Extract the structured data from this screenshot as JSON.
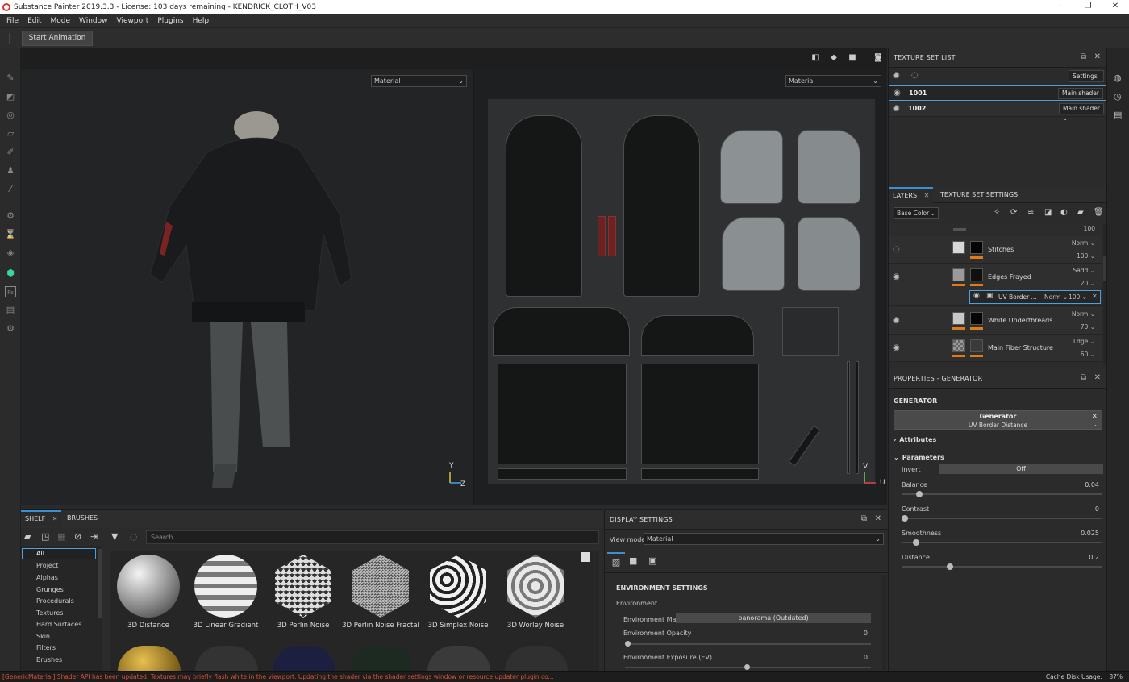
{
  "window": {
    "title": "Substance Painter 2019.3.3 - License: 103 days remaining - KENDRICK_CLOTH_V03",
    "minimize": "–",
    "maximize": "❐",
    "close": "✕"
  },
  "menu": [
    "File",
    "Edit",
    "Mode",
    "Window",
    "Viewport",
    "Plugins",
    "Help"
  ],
  "toolbar": {
    "start_animation": "Start Animation"
  },
  "viewport": {
    "left_mode": "Material",
    "right_mode": "Material",
    "axis_3d_y": "Y",
    "axis_3d_z": "Z",
    "axis_2d_v": "V",
    "axis_2d_u": "U"
  },
  "texture_set_list": {
    "title": "TEXTURE SET LIST",
    "settings": "Settings",
    "sets": [
      {
        "name": "1001",
        "shader": "Main shader"
      },
      {
        "name": "1002",
        "shader": "Main shader"
      }
    ]
  },
  "layers_panel": {
    "tab_layers": "LAYERS",
    "tab_texture_set_settings": "TEXTURE SET SETTINGS",
    "channel": "Base Color",
    "top_value": "100",
    "layers": [
      {
        "name": "Stitches",
        "blend": "Norm",
        "opacity": "100"
      },
      {
        "name": "Edges Frayed",
        "blend": "Sadd",
        "opacity": "20"
      },
      {
        "name": "White Underthreads",
        "blend": "Norm",
        "opacity": "70"
      },
      {
        "name": "Main Fiber Structure",
        "blend": "Ldge",
        "opacity": "60"
      }
    ],
    "sublayer": {
      "name": "UV Border ...",
      "blend": "Norm",
      "opacity": "100"
    }
  },
  "properties": {
    "title": "PROPERTIES - GENERATOR",
    "section": "GENERATOR",
    "generator_label": "Generator",
    "generator_name": "UV Border Distance",
    "attributes": "Attributes",
    "parameters": "Parameters",
    "invert_label": "Invert",
    "invert_value": "Off",
    "params": [
      {
        "label": "Balance",
        "value": "0.04",
        "fraction": 0.04
      },
      {
        "label": "Contrast",
        "value": "0",
        "fraction": 0.0
      },
      {
        "label": "Smoothness",
        "value": "0.025",
        "fraction": 0.025
      },
      {
        "label": "Distance",
        "value": "0.2",
        "fraction": 0.2
      }
    ]
  },
  "shelf": {
    "tab_shelf": "SHELF",
    "tab_brushes": "BRUSHES",
    "search_placeholder": "Search...",
    "categories": [
      "All",
      "Project",
      "Alphas",
      "Grunges",
      "Procedurals",
      "Textures",
      "Hard Surfaces",
      "Skin",
      "Filters",
      "Brushes"
    ],
    "items": [
      "3D Distance",
      "3D Linear Gradient",
      "3D Perlin Noise",
      "3D Perlin Noise Fractal",
      "3D Simplex Noise",
      "3D Worley Noise"
    ]
  },
  "display_settings": {
    "title": "DISPLAY SETTINGS",
    "view_mode_label": "View mode",
    "view_mode": "Material",
    "env_header": "ENVIRONMENT SETTINGS",
    "environment": "Environment",
    "env_map_label": "Environment Map",
    "env_map_value": "panorama (Outdated)",
    "env_opacity_label": "Environment Opacity",
    "env_opacity_value": "0",
    "env_exposure_label": "Environment Exposure (EV)",
    "env_exposure_value": "0"
  },
  "status": {
    "message": "[GenericMaterial] Shader API has been updated. Textures may briefly flash white in the viewport. Updating the shader via the shader settings window or resource updater plugin co...",
    "cache_label": "Cache Disk Usage:",
    "cache_value": "87%"
  },
  "colors": {
    "accent": "#3b8fd6",
    "status_error": "#e0503c",
    "layer_orange": "#e07b1a"
  }
}
